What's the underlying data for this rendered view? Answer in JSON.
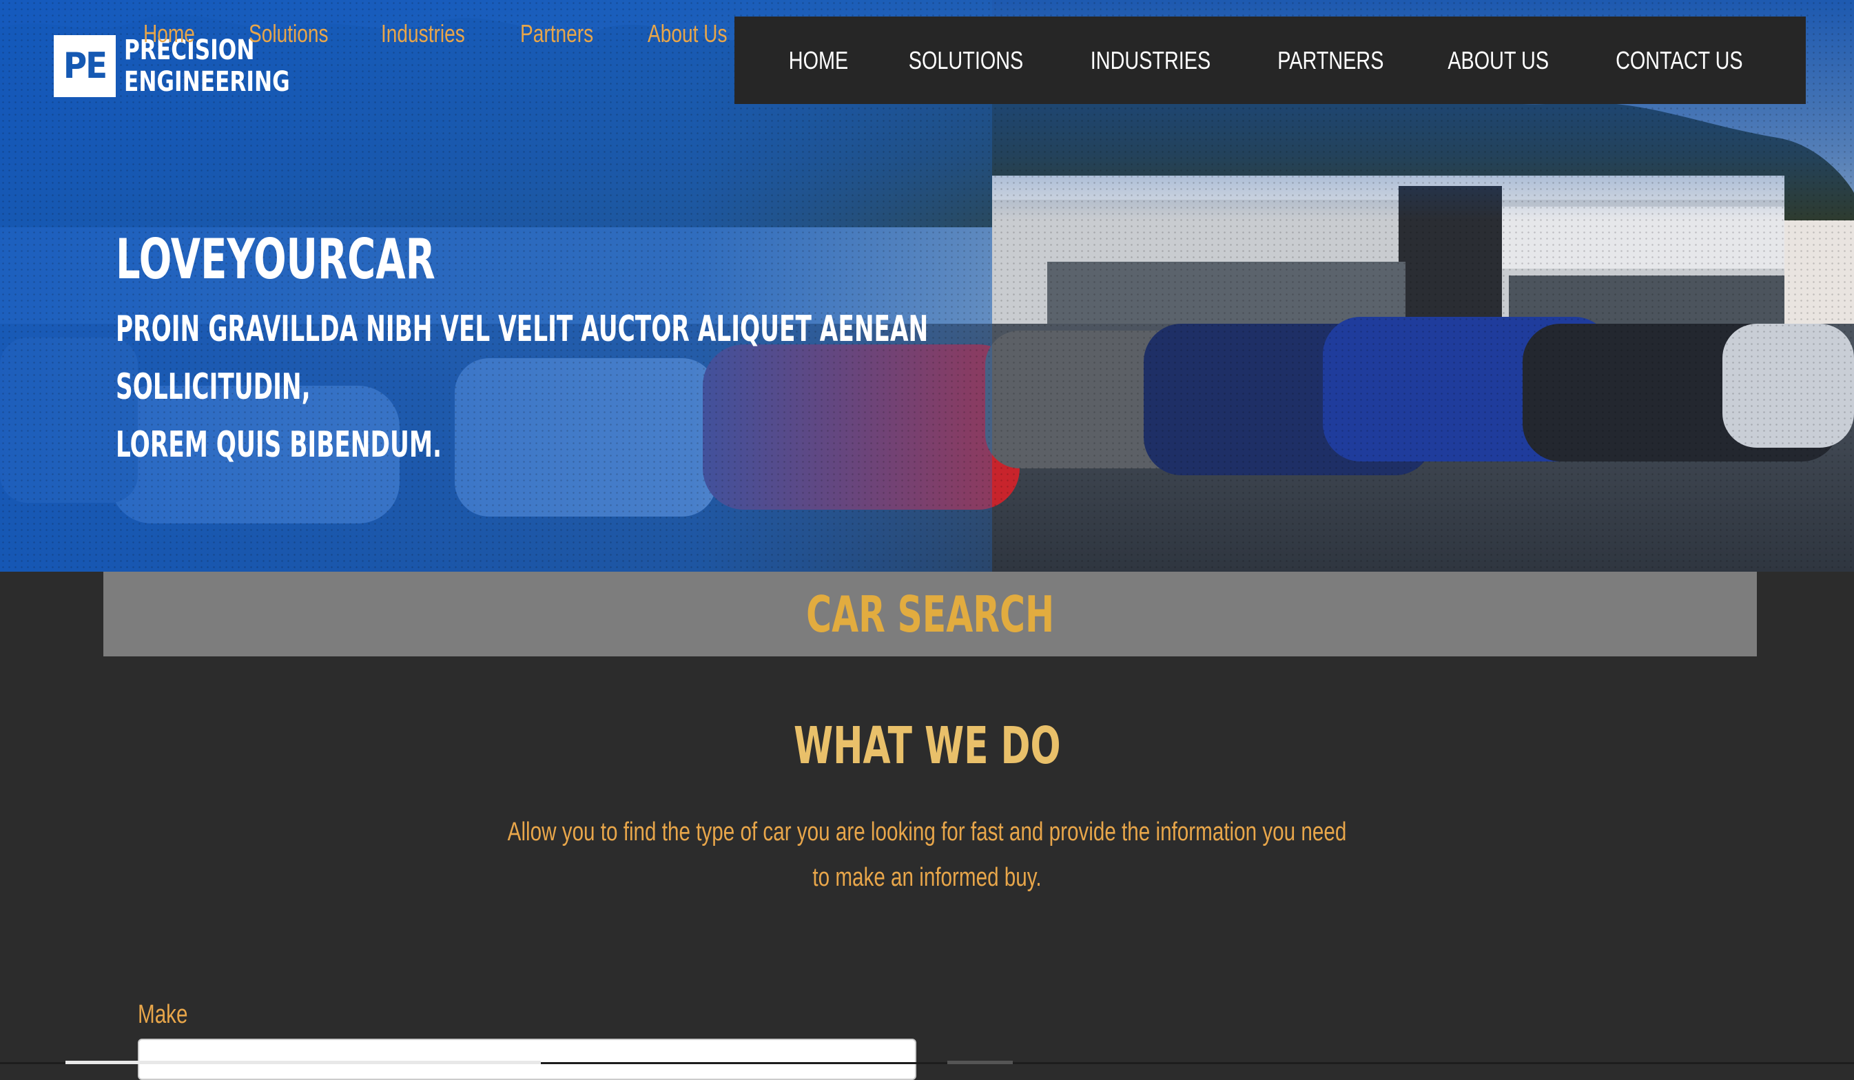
{
  "logo": {
    "mark": "PE",
    "line1": "PRECISION",
    "line2": "ENGINEERING"
  },
  "ghost_nav": [
    "Home",
    "Solutions",
    "Industries",
    "Partners",
    "About Us"
  ],
  "main_nav": [
    "HOME",
    "SOLUTIONS",
    "INDUSTRIES",
    "PARTNERS",
    "ABOUT US",
    "CONTACT US"
  ],
  "hero": {
    "title": "LOVEYOURCAR",
    "subtitle_line1": "PROIN GRAVILLDA NIBH VEL VELIT AUCTOR ALIQUET AENEAN SOLLICITUDIN,",
    "subtitle_line2": "LOREM QUIS BIBENDUM."
  },
  "car_search": {
    "heading": "CAR SEARCH"
  },
  "what_we_do": {
    "heading": "WHAT WE DO",
    "line1": "Allow you to find the type of car you are looking for fast and provide the information you need",
    "line2": "to make an informed buy."
  },
  "form": {
    "make_label": "Make",
    "make_value": ""
  },
  "colors": {
    "accent_gold": "#e2ac3f",
    "accent_orange": "#e8a64a",
    "nav_bg": "#262626",
    "page_bg": "#2c2c2c",
    "hero_blue": "#1559b3"
  }
}
